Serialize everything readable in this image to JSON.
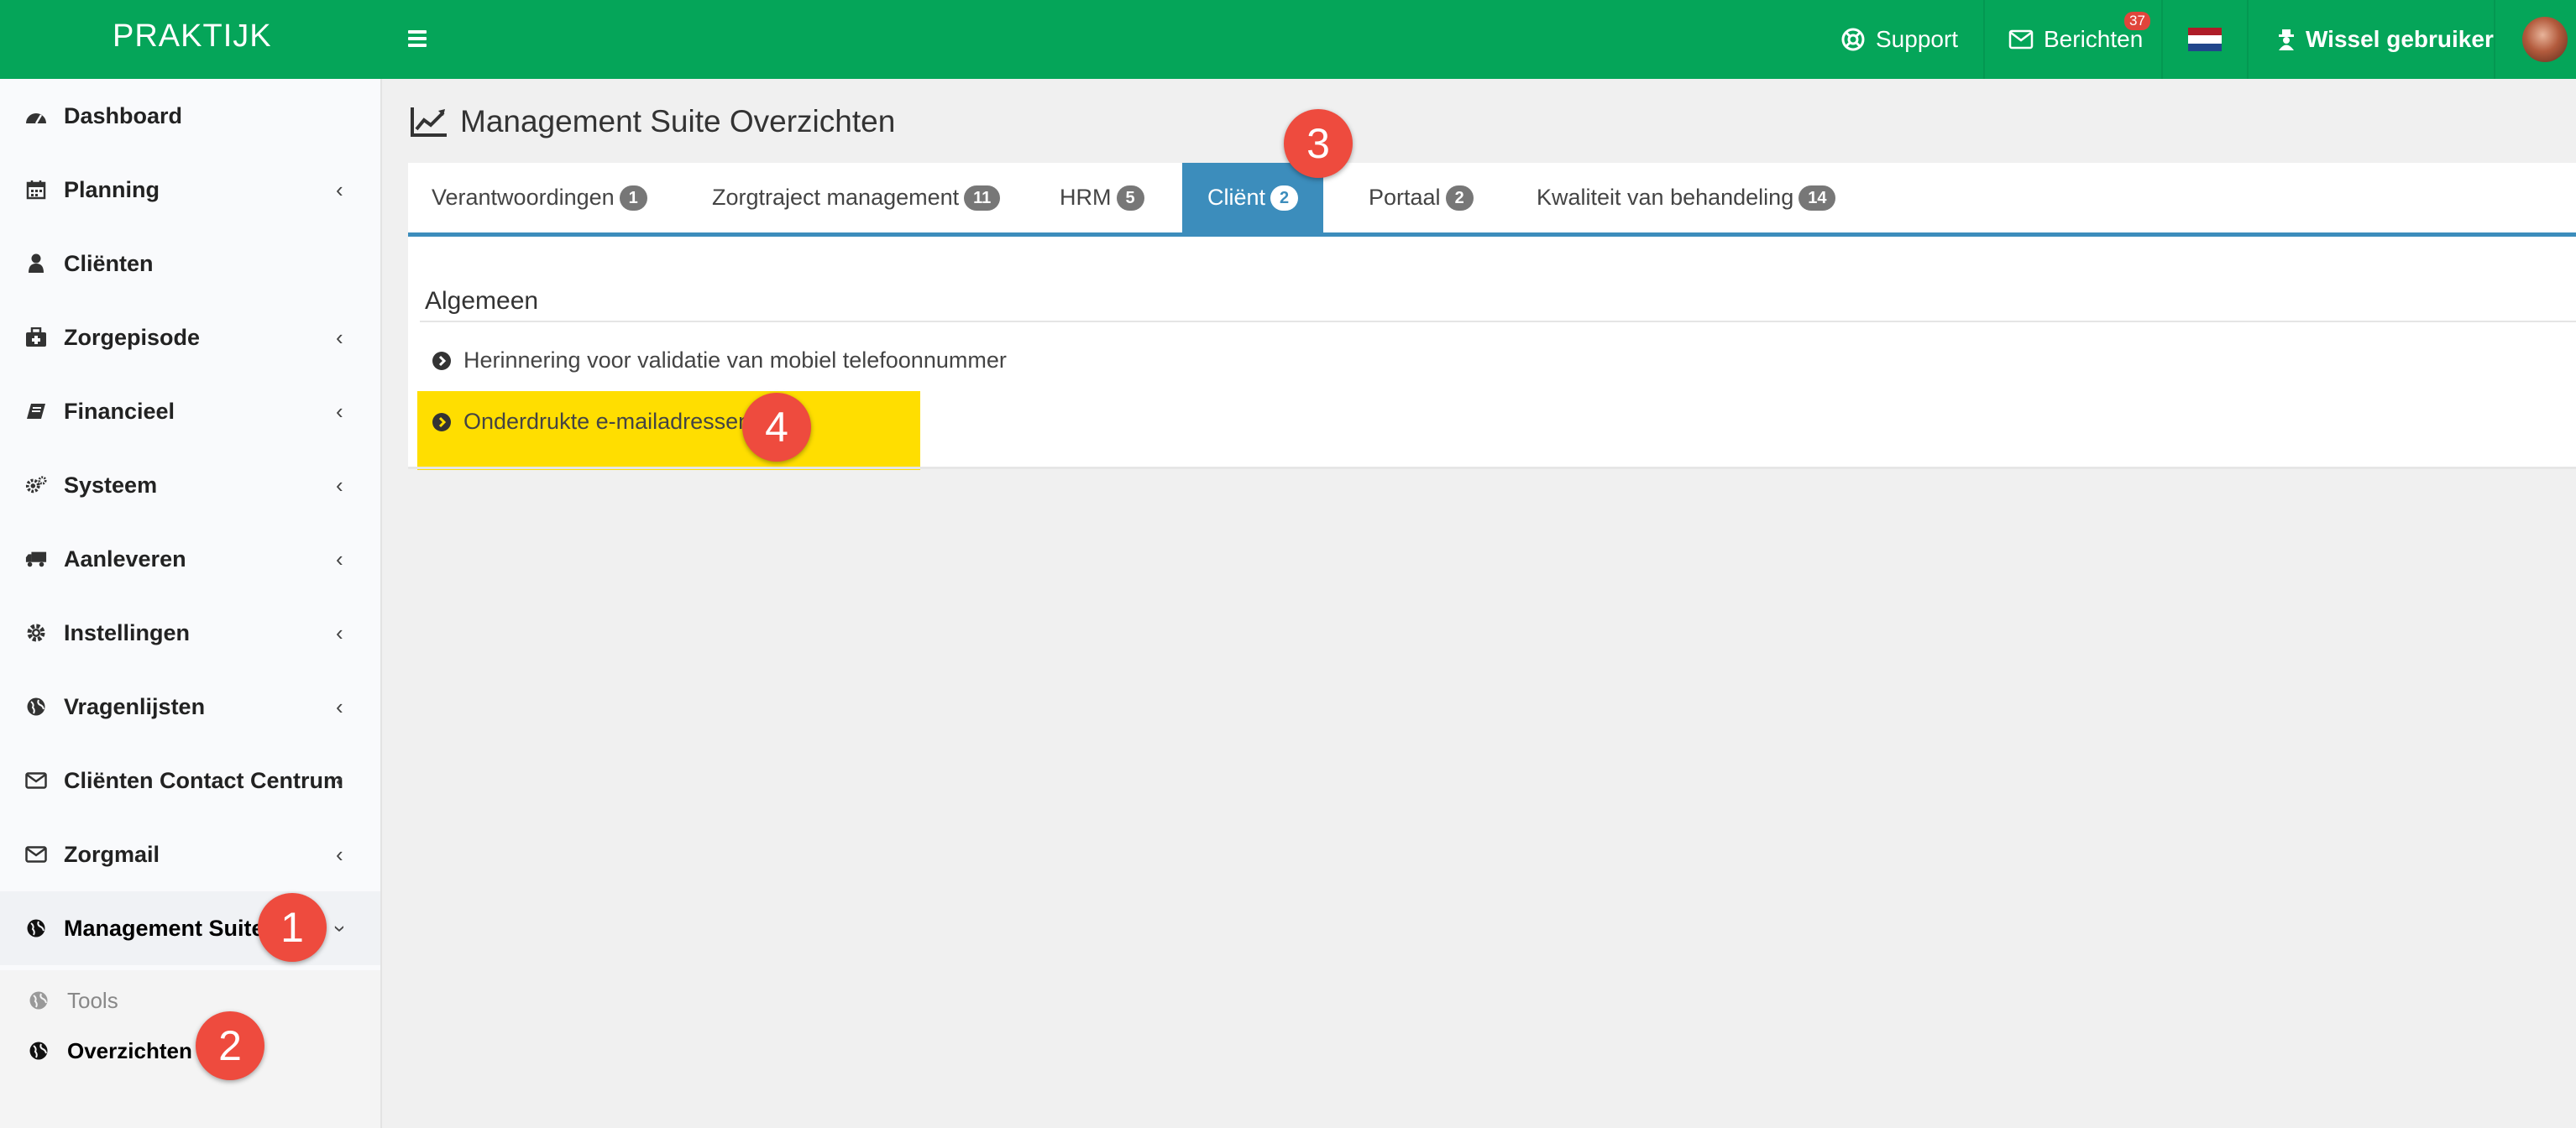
{
  "header": {
    "brand": "PRAKTIJK",
    "support_label": "Support",
    "messages_label": "Berichten",
    "messages_count": "37",
    "switch_user_label": "Wissel gebruiker",
    "flag_colors": [
      "#ae1c28",
      "#ffffff",
      "#21468b"
    ]
  },
  "sidebar": {
    "items": [
      {
        "label": "Dashboard",
        "icon": "dashboard-icon"
      },
      {
        "label": "Planning",
        "icon": "calendar-icon"
      },
      {
        "label": "Cliënten",
        "icon": "user-icon"
      },
      {
        "label": "Zorgepisode",
        "icon": "medkit-icon"
      },
      {
        "label": "Financieel",
        "icon": "book-icon"
      },
      {
        "label": "Systeem",
        "icon": "cogs-icon"
      },
      {
        "label": "Aanleveren",
        "icon": "truck-icon"
      },
      {
        "label": "Instellingen",
        "icon": "gear-icon"
      },
      {
        "label": "Vragenlijsten",
        "icon": "globe-icon"
      },
      {
        "label": "Cliënten Contact Centrum",
        "icon": "envelope-icon"
      },
      {
        "label": "Zorgmail",
        "icon": "envelope-icon"
      },
      {
        "label": "Management Suite",
        "icon": "globe-icon"
      }
    ],
    "subitems": [
      {
        "label": "Tools"
      },
      {
        "label": "Overzichten"
      }
    ]
  },
  "main": {
    "title": "Management Suite Overzichten",
    "tabs": [
      {
        "label": "Verantwoordingen",
        "count": "1"
      },
      {
        "label": "Zorgtraject management",
        "count": "11"
      },
      {
        "label": "HRM",
        "count": "5"
      },
      {
        "label": "Cliënt",
        "count": "2"
      },
      {
        "label": "Portaal",
        "count": "2"
      },
      {
        "label": "Kwaliteit van behandeling",
        "count": "14"
      }
    ],
    "section_title": "Algemeen",
    "links": [
      {
        "label": "Herinnering voor validatie van mobiel telefoonnummer"
      },
      {
        "label": "Onderdrukte e-mailadressen"
      }
    ]
  },
  "markers": [
    "1",
    "2",
    "3",
    "4"
  ],
  "colors": {
    "topbar": "#05a559",
    "tab_active": "#3c8dbc",
    "highlight": "#ffde00",
    "marker": "#ee4b3e"
  }
}
